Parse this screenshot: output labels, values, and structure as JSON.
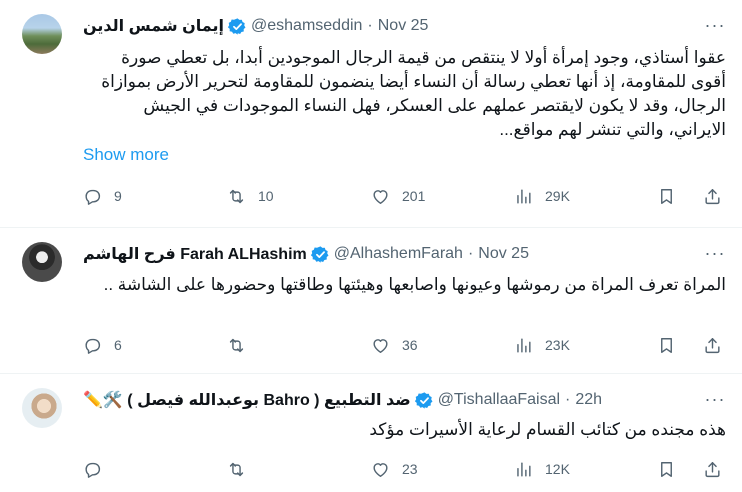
{
  "tweets": [
    {
      "name": "إيمان شمس الدين",
      "handle": "@eshamseddin",
      "time": "Nov 25",
      "text": "عقوا أستاذي، وجود إمرأة أولا لا ينتقص من قيمة الرجال الموجودين أبدا، بل تعطي صورة أقوى للمقاومة، إذ أنها تعطي رسالة أن  النساء أيضا ينضمون للمقاومة  لتحرير الأرض بموازاة الرجال، وقد لا يكون  لايقتصر عملهم على العسكر، فهل النساء الموجودات في الجيش الايراني، والتي تنشر لهم مواقع...",
      "show_more": "Show more",
      "replies": "9",
      "reposts": "10",
      "likes": "201",
      "views": "29K"
    },
    {
      "name": "Farah ALHashim فرح الهاشم",
      "handle": "@AlhashemFarah",
      "time": "Nov 25",
      "text": "المراة تعرف المراة من رموشها وعيونها واصابعها وهيئتها وطاقتها وحضورها على الشاشة ..",
      "replies": "6",
      "reposts": "",
      "likes": "36",
      "views": "23K"
    },
    {
      "name": "ضد التطبيع ( Bahro بوعبدالله فيصل ) 🛠️✏️",
      "handle": "@TishallaaFaisal",
      "time": "22h",
      "text": "هذه مجنده من كتائب القسام لرعاية الأسيرات  مؤكد",
      "replies": "",
      "reposts": "",
      "likes": "23",
      "views": "12K"
    }
  ],
  "icons": {
    "more": "more-dots-icon",
    "verified": "verified-badge-icon",
    "reply": "reply-icon",
    "repost": "repost-icon",
    "like": "heart-icon",
    "views": "views-chart-icon",
    "bookmark": "bookmark-icon",
    "share": "share-icon"
  },
  "colors": {
    "link": "#1d9bf0",
    "muted": "#536471",
    "verified": "#1d9bf0"
  }
}
